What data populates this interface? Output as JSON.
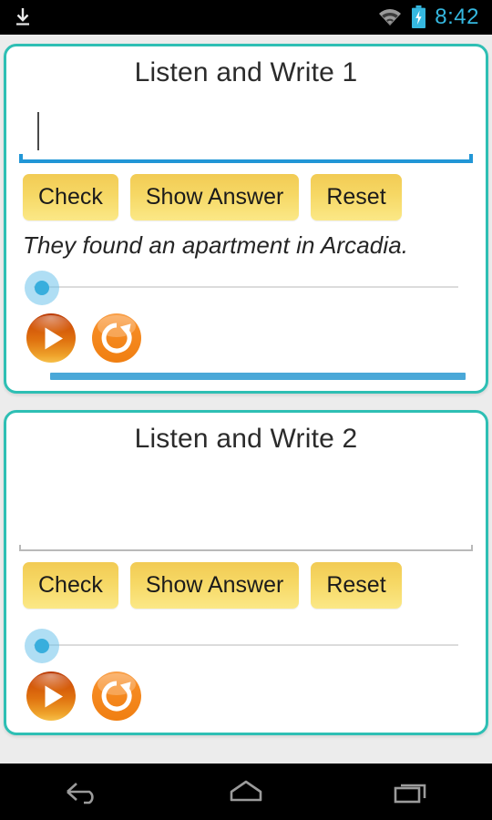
{
  "status_bar": {
    "download_icon": "download-icon",
    "wifi_icon": "wifi-icon",
    "battery_icon": "battery-charging-icon",
    "time": "8:42",
    "time_color": "#35b8e0"
  },
  "theme": {
    "card_border": "#2ebfb4",
    "button_yellow": "#f6d865",
    "accent_blue": "#2196d6",
    "progress_blue": "#4aa8d8",
    "play_orange": "#e2761a",
    "replay_orange": "#f58220",
    "page_background": "#ececec"
  },
  "cards": [
    {
      "title": "Listen and Write 1",
      "input": {
        "value": "",
        "placeholder": "",
        "focused": true
      },
      "buttons": {
        "check": "Check",
        "show_answer": "Show Answer",
        "reset": "Reset"
      },
      "answer_text": "They found an apartment in Arcadia.",
      "answer_revealed": true,
      "seek_position_percent": 0,
      "media": {
        "play_icon": "play-icon",
        "replay_icon": "replay-icon"
      },
      "progress_percent": 100
    },
    {
      "title": "Listen and Write 2",
      "input": {
        "value": "",
        "placeholder": "",
        "focused": false
      },
      "buttons": {
        "check": "Check",
        "show_answer": "Show Answer",
        "reset": "Reset"
      },
      "answer_text": "",
      "answer_revealed": false,
      "seek_position_percent": 0,
      "media": {
        "play_icon": "play-icon",
        "replay_icon": "replay-icon"
      },
      "progress_percent": 0
    }
  ],
  "nav_bar": {
    "back": "back-icon",
    "home": "home-icon",
    "recents": "recents-icon"
  }
}
